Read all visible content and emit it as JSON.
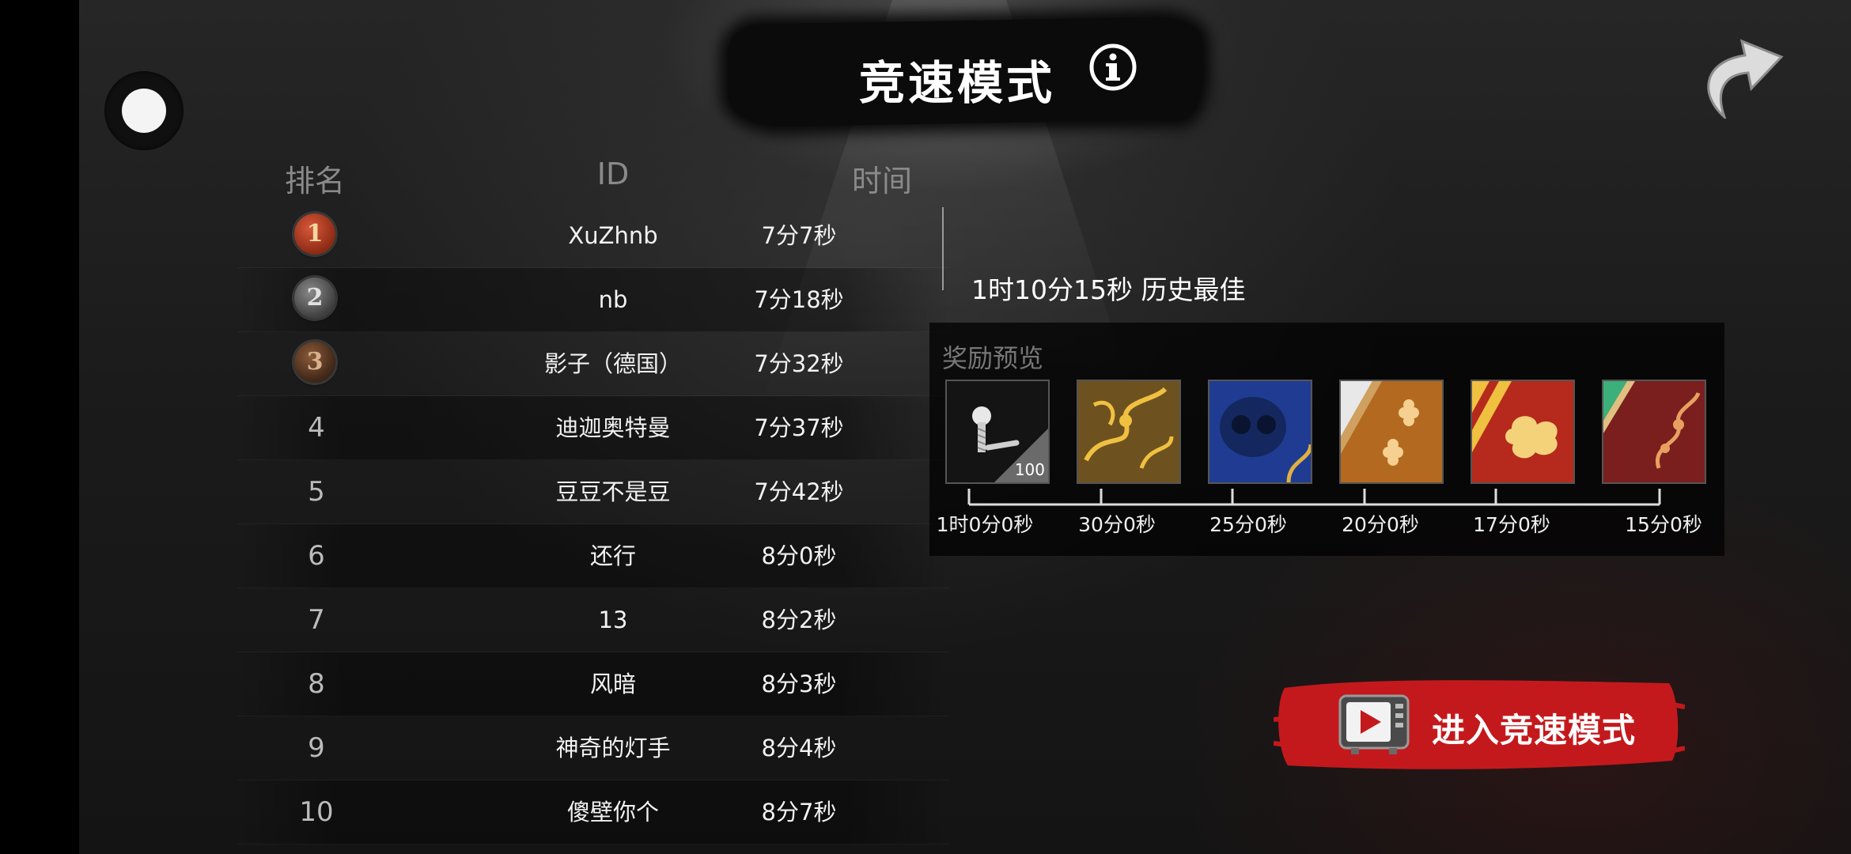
{
  "header": {
    "title": "竞速模式"
  },
  "icons": {
    "info": "info-icon",
    "share": "share-arrow-icon",
    "record": "record-button"
  },
  "leaderboard": {
    "columns": [
      "排名",
      "ID",
      "时间"
    ],
    "rows": [
      {
        "rank": "1",
        "id": "XuZhnb",
        "time": "7分7秒"
      },
      {
        "rank": "2",
        "id": "nb",
        "time": "7分18秒"
      },
      {
        "rank": "3",
        "id": "影子（德国）",
        "time": "7分32秒"
      },
      {
        "rank": "4",
        "id": "迪迦奥特曼",
        "time": "7分37秒"
      },
      {
        "rank": "5",
        "id": "豆豆不是豆",
        "time": "7分42秒"
      },
      {
        "rank": "6",
        "id": "还行",
        "time": "8分0秒"
      },
      {
        "rank": "7",
        "id": "13",
        "time": "8分2秒"
      },
      {
        "rank": "8",
        "id": "风暗",
        "time": "8分3秒"
      },
      {
        "rank": "9",
        "id": "神奇的灯手",
        "time": "8分4秒"
      },
      {
        "rank": "10",
        "id": "傻壁你个",
        "time": "8分7秒"
      }
    ]
  },
  "best": {
    "text": "1时10分15秒 历史最佳"
  },
  "rewards": {
    "title": "奖励预览",
    "items": [
      {
        "label": "1时0分0秒",
        "kind": "screw-item",
        "count": "100"
      },
      {
        "label": "30分0秒",
        "kind": "gold-floral-skin"
      },
      {
        "label": "25分0秒",
        "kind": "blue-skull-skin"
      },
      {
        "label": "20分0秒",
        "kind": "orange-floral-skin"
      },
      {
        "label": "17分0秒",
        "kind": "red-cloud-skin"
      },
      {
        "label": "15分0秒",
        "kind": "maroon-floral-skin"
      }
    ]
  },
  "enter": {
    "label": "进入竞速模式"
  },
  "colors": {
    "accent_red": "#c4191c",
    "panel_bg": "#0b0b0b",
    "muted_text": "#8a8a8a"
  }
}
